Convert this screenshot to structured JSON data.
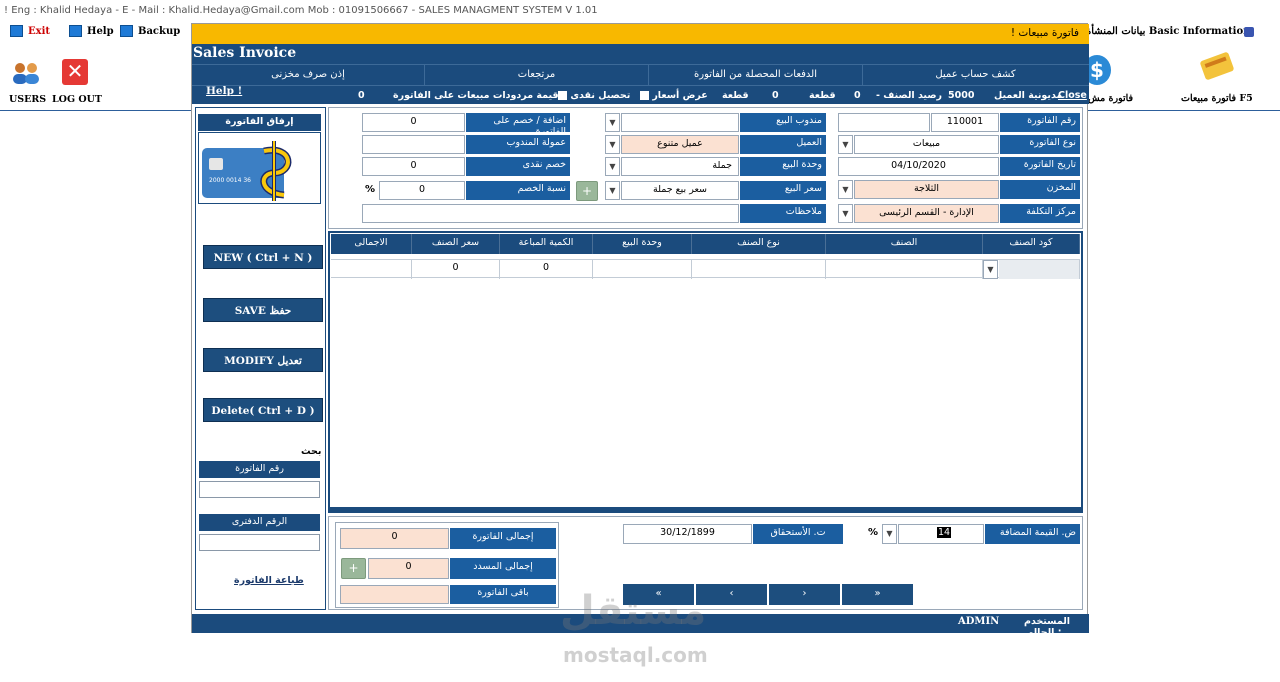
{
  "app": {
    "title": "! Eng : Khalid Hedaya - E - Mail : Khalid.Hedaya@Gmail.com Mob : 01091506667 - SALES  MANAGMENT SYSTEM V 1.01"
  },
  "menu": {
    "exit": "Exit",
    "help": "Help",
    "backup": "Backup",
    "company_info": "بيانات المنشأة Basic Information"
  },
  "toolbar": {
    "users": "USERS",
    "logout": "LOG OUT",
    "sales_invoice_f5": "فاتورة مبيعات F5",
    "facility_short": "فاتورة مش"
  },
  "window": {
    "title": "فاتورة مبيعات  !",
    "heading": "Sales Invoice",
    "tabs": [
      "كشف حساب عميل",
      "الدفعات المحصلة من الفاتورة",
      "مرتجعات",
      "إذن صرف مخزنى"
    ],
    "info": {
      "close": "Close",
      "customer_debt_label": "مديونية العميل",
      "customer_debt": "5000",
      "item_balance_label": "- رصيد الصنف",
      "item_balance": "0",
      "unit1": "قطعة",
      "qty1": "0",
      "unit2": "قطعة",
      "price_view": "عرض أسعار",
      "cash_collect": "تحصيل نقدى",
      "returns_label": "قيمة مردودات مبيعات على الفاتورة",
      "returns_value": "0",
      "help": "Help !"
    }
  },
  "form": {
    "invoice_no_label": "رقم الفاتورة",
    "invoice_no": "110001",
    "invoice_type_label": "نوع الفاتورة",
    "invoice_type": "مبيعات",
    "invoice_date_label": "تاريخ الفاتورة",
    "invoice_date": "04/10/2020",
    "store_label": "المخزن",
    "store": "الثلاجة",
    "cost_center_label": "مركز التكلفة",
    "cost_center": "الإدارة - القسم الرئيسى",
    "sales_rep_label": "مندوب البيع",
    "sales_rep": "",
    "customer_label": "العميل",
    "customer": "عميل متنوع",
    "sale_unit_label": "وحدة البيع",
    "sale_unit": "جملة",
    "sale_price_label": "سعر البيع",
    "sale_price": "سعر بيع جملة",
    "notes_label": "ملاحظات",
    "notes": "",
    "add_discount_label": "اضافة / خصم على الفاتورة",
    "add_discount": "0",
    "rep_commission_label": "عمولة المندوب",
    "rep_commission": "",
    "cash_discount_label": "خصم نقدى",
    "cash_discount": "0",
    "discount_pct_label": "نسبة الخصم",
    "discount_pct": "0",
    "pct_sign": "%"
  },
  "sidebar": {
    "attach_label": "إرفاق الفاتورة",
    "card_digits": "2000 0014 36",
    "new_btn": "NEW ( Ctrl + N )",
    "save_btn": "SAVE   حفظ",
    "modify_btn": "MODIFY  تعديل",
    "delete_btn": "Delete( Ctrl + D )",
    "search_label": "بحث",
    "search_invoice_label": "رقم الفاتورة",
    "search_book_label": "الرقم الدفترى",
    "print_link": "طباعة الفاتورة"
  },
  "grid": {
    "headers": [
      "كود الصنف",
      "الصنف",
      "نوع الصنف",
      "وحدة البيع",
      "الكمية المباعة",
      "سعر الصنف",
      "الاجمالى"
    ],
    "row": {
      "code": "",
      "item": "",
      "item_type": "",
      "unit": "",
      "qty": "0",
      "price": "0",
      "total": ""
    }
  },
  "footer": {
    "vat_label": "ض. القيمة المضافة",
    "vat_value": "14",
    "pct": "%",
    "due_label": "ت. الأستحقاق",
    "due_date": "30/12/1899",
    "total_label": "إجمالى الفاتورة",
    "total": "0",
    "paid_label": "إجمالى المسدد",
    "paid": "0",
    "remaining_label": "باقى الفاتورة",
    "remaining": "",
    "nav": [
      "«",
      "‹",
      "›",
      "»"
    ],
    "current_user_label": "المستخدم الحالى :",
    "current_user": "ADMIN"
  },
  "watermark": {
    "ar": "مستقل",
    "en": "mostaql.com"
  },
  "colors": {
    "navy": "#1b4b7d",
    "accent": "#f8b800",
    "pink": "#fbe1d2"
  }
}
